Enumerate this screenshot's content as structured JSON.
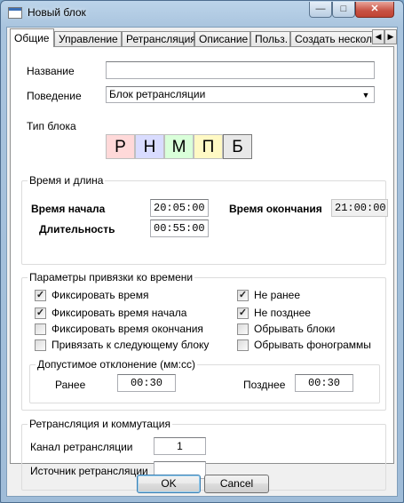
{
  "window": {
    "title": "Новый блок"
  },
  "tabs": [
    "Общие",
    "Управление",
    "Ретрансляция",
    "Описание",
    "Польз.",
    "Создать нескол"
  ],
  "general": {
    "name_label": "Название",
    "name_value": "",
    "behavior_label": "Поведение",
    "behavior_value": "Блок ретрансляции",
    "block_type_label": "Тип блока",
    "block_types": [
      "Р",
      "Н",
      "М",
      "П",
      "Б"
    ],
    "block_type_colors": [
      "#ffd9d9",
      "#d9dcff",
      "#d9ffd9",
      "#fff9c4",
      "#e8e8e8"
    ],
    "selected_block_type": "Б"
  },
  "timing": {
    "title": "Время и длина",
    "start_label": "Время начала",
    "start_value": "20:05:00",
    "end_label": "Время окончания",
    "end_value": "21:00:00",
    "duration_label": "Длительность",
    "duration_value": "00:55:00"
  },
  "binding": {
    "title": "Параметры привязки ко времени",
    "left": [
      {
        "label": "Фиксировать время",
        "checked": true
      },
      {
        "label": "Фиксировать время начала",
        "checked": true
      },
      {
        "label": "Фиксировать время окончания",
        "checked": false
      },
      {
        "label": "Привязать к следующему блоку",
        "checked": false
      }
    ],
    "right": [
      {
        "label": "Не ранее",
        "checked": true
      },
      {
        "label": "Не позднее",
        "checked": true
      },
      {
        "label": "Обрывать блоки",
        "checked": false
      },
      {
        "label": "Обрывать фонограммы",
        "checked": false
      }
    ],
    "tolerance": {
      "title": "Допустимое отклонение (мм:сс)",
      "earlier_label": "Ранее",
      "earlier_value": "00:30",
      "later_label": "Позднее",
      "later_value": "00:30"
    }
  },
  "relay": {
    "title": "Ретрансляция и коммутация",
    "channel_label": "Канал ретрансляции",
    "channel_value": "1",
    "source_label": "Источник ретрансляции",
    "source_value": ""
  },
  "buttons": {
    "ok": "OK",
    "cancel": "Cancel"
  },
  "icons": {
    "tab_left": "◀",
    "tab_right": "▶",
    "dropdown": "▼",
    "minimize": "—",
    "maximize": "□",
    "close": "✕",
    "check": "✓"
  }
}
